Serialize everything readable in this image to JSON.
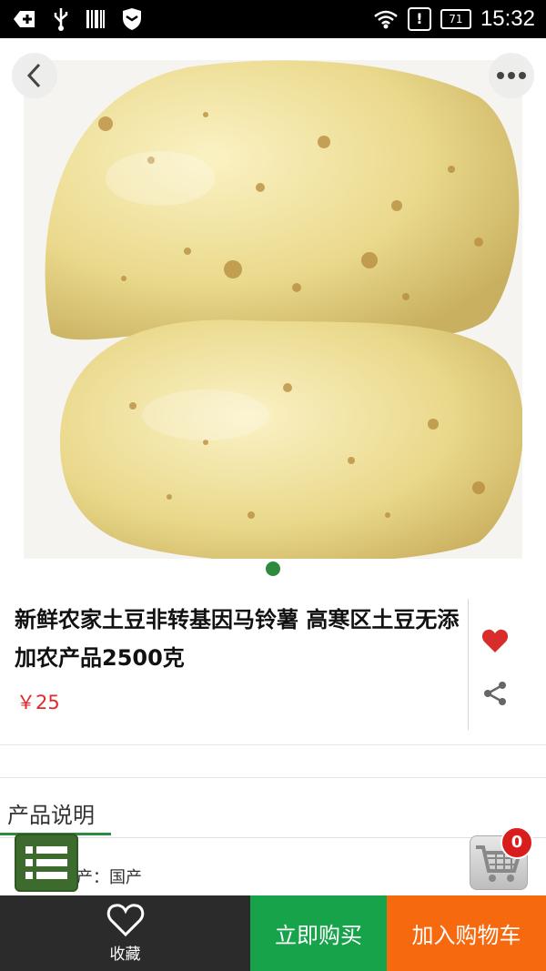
{
  "status_bar": {
    "time": "15:32",
    "battery": "71"
  },
  "product": {
    "title": "新鲜农家土豆非转基因马铃薯 高寒区土豆无添加农产品2500克",
    "price": "￥25",
    "image_page_count": 1,
    "image_page_index": 1
  },
  "section": {
    "title": "产品说明",
    "origin_text": "产：国产"
  },
  "cart": {
    "badge_count": "0"
  },
  "bottom_bar": {
    "favorite_label": "收藏",
    "buy_now_label": "立即购买",
    "add_to_cart_label": "加入购物车"
  },
  "colors": {
    "accent_green": "#2e8b3e",
    "buy_green": "#17a34a",
    "cart_orange": "#f6690e",
    "price_red": "#e12a2a",
    "heart_red": "#d92d2d"
  }
}
